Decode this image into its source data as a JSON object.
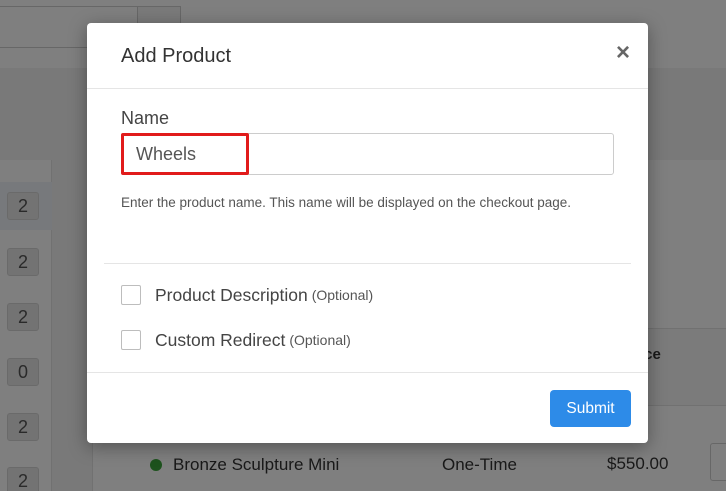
{
  "background": {
    "side_badges": [
      "2",
      "2",
      "2",
      "0",
      "2",
      "2"
    ],
    "table_col_fragment": "ice",
    "row": {
      "product_name": "Bronze Sculpture Mini",
      "type": "One-Time",
      "price": "$550.00",
      "status_color": "#3aa53a"
    }
  },
  "modal": {
    "title": "Add Product",
    "close_glyph": "×",
    "name_label": "Name",
    "name_value": "Wheels",
    "help_text": "Enter the product name. This name will be displayed on the checkout page.",
    "options": [
      {
        "label": "Product Description",
        "note": "(Optional)"
      },
      {
        "label": "Custom Redirect",
        "note": "(Optional)"
      }
    ],
    "submit_label": "Submit"
  },
  "colors": {
    "accent": "#2d8be8",
    "highlight": "#e11b1b"
  }
}
